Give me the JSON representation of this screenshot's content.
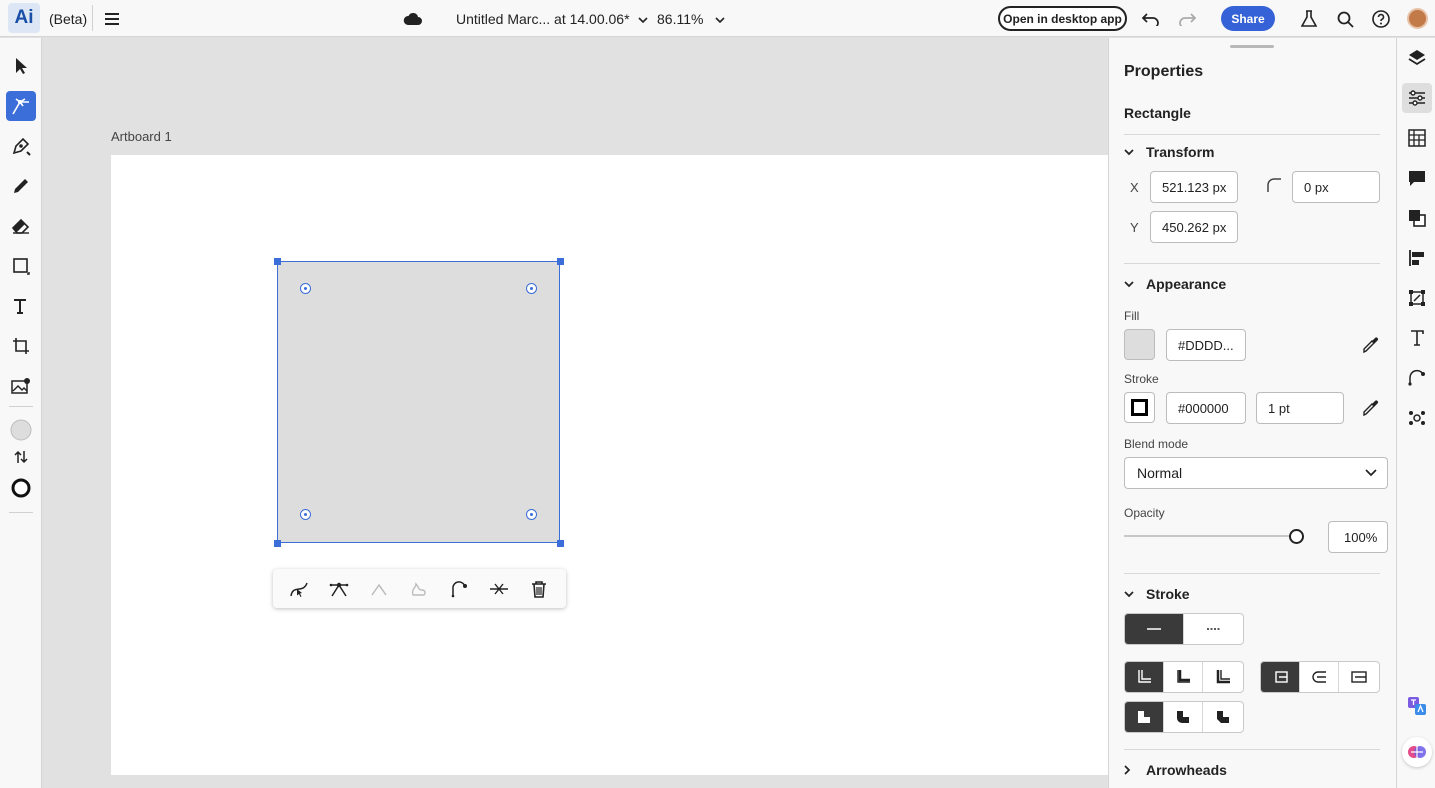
{
  "app": {
    "logo": "Ai",
    "beta_label": "(Beta)"
  },
  "document": {
    "title": "Untitled Marc... at 14.00.06*",
    "zoom": "86.11%"
  },
  "topbar": {
    "open_desktop_label": "Open in desktop app",
    "share_label": "Share"
  },
  "canvas": {
    "artboard_label": "Artboard 1"
  },
  "properties": {
    "title": "Properties",
    "object_type": "Rectangle",
    "transform": {
      "heading": "Transform",
      "x_label": "X",
      "x_value": "521.123 px",
      "y_label": "Y",
      "y_value": "450.262 px",
      "corner_value": "0 px"
    },
    "appearance": {
      "heading": "Appearance",
      "fill_label": "Fill",
      "fill_color": "#DDDD...",
      "fill_swatch": "#dddddd",
      "stroke_label": "Stroke",
      "stroke_color": "#000000",
      "stroke_weight": "1 pt",
      "blend_label": "Blend mode",
      "blend_value": "Normal",
      "opacity_label": "Opacity",
      "opacity_value": "100%",
      "opacity_level": 1.0
    },
    "stroke_section": {
      "heading": "Stroke"
    },
    "arrowheads": {
      "heading": "Arrowheads"
    }
  },
  "colors": {
    "accent": "#3b6ed8",
    "share": "#3562d6",
    "selection": "#3b6ed8"
  }
}
